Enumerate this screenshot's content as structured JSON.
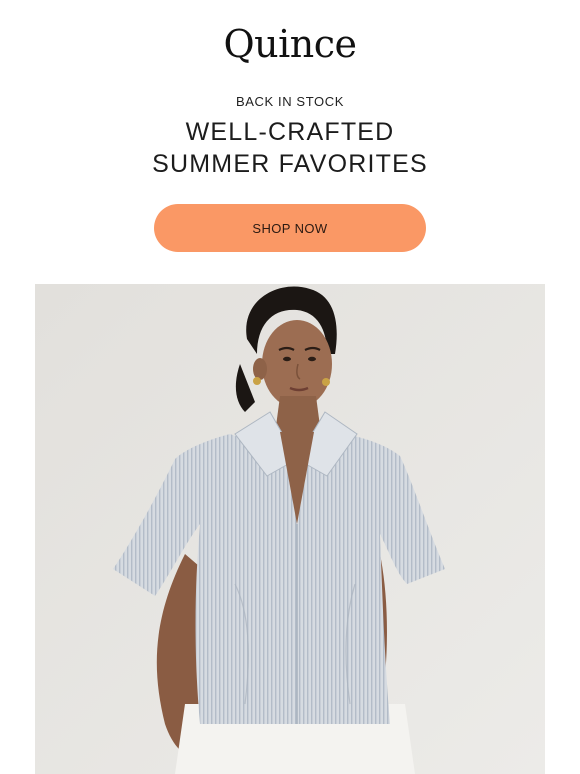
{
  "brand": {
    "name": "Quince"
  },
  "eyebrow": "BACK IN STOCK",
  "headline": {
    "line1": "WELL-CRAFTED",
    "line2": "SUMMER FAVORITES"
  },
  "cta": {
    "label": "SHOP NOW",
    "color": "#fa9865"
  },
  "hero": {
    "icon": "model-photo",
    "background_color": "#e5e3df",
    "shirt_color": "#c9d0d8"
  }
}
